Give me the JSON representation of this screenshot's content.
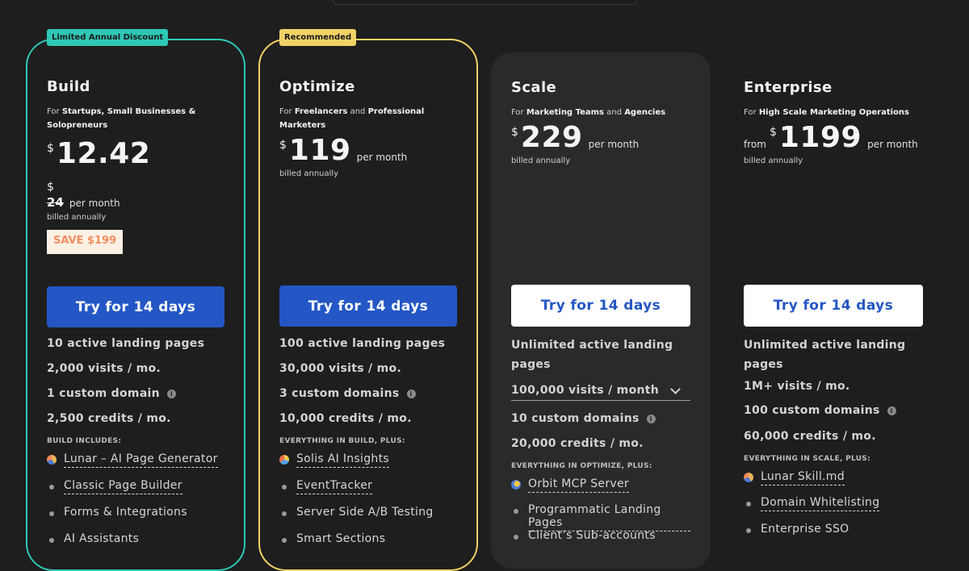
{
  "plans": [
    {
      "name": "Build",
      "badge": "Limited Annual Discount",
      "for_prefix": "For",
      "for_bold1": "Startups, Small Businesses & Solopreneurs",
      "currency": "$",
      "price": "12.42",
      "old_currency": "$",
      "old_price": "24",
      "per": "per month",
      "billed": "billed annually",
      "save": "SAVE $199",
      "cta": "Try for 14 days",
      "features": [
        "10 active landing pages",
        "2,000 visits / mo.",
        "1 custom domain",
        "2,500 credits / mo."
      ],
      "includes_head": "BUILD INCLUDES:",
      "includes": [
        "Lunar – AI Page Generator",
        "Classic Page Builder",
        "Forms & Integrations",
        "AI Assistants"
      ]
    },
    {
      "name": "Optimize",
      "badge": "Recommended",
      "for_prefix": "For",
      "for_bold1": "Freelancers",
      "for_mid": "and",
      "for_bold2": "Professional Marketers",
      "currency": "$",
      "price": "119",
      "per": "per month",
      "billed": "billed annually",
      "cta": "Try for 14 days",
      "features": [
        "100 active landing pages",
        "30,000 visits / mo.",
        "3 custom domains",
        "10,000 credits / mo."
      ],
      "includes_head": "EVERYTHING IN BUILD, PLUS:",
      "includes": [
        "Solis AI Insights",
        "EventTracker",
        "Server Side A/B Testing",
        "Smart Sections"
      ]
    },
    {
      "name": "Scale",
      "for_prefix": "For",
      "for_bold1": "Marketing Teams",
      "for_mid": "and",
      "for_bold2": "Agencies",
      "currency": "$",
      "price": "229",
      "per": "per month",
      "billed": "billed annually",
      "cta": "Try for 14 days",
      "features": [
        "Unlimited active landing pages",
        "100,000 visits / month",
        "10 custom domains",
        "20,000 credits / mo."
      ],
      "includes_head": "EVERYTHING IN OPTIMIZE, PLUS:",
      "includes": [
        "Orbit MCP Server",
        "Programmatic Landing Pages",
        "Client’s Sub-accounts"
      ]
    },
    {
      "name": "Enterprise",
      "for_prefix": "For",
      "for_bold1": "High Scale Marketing Operations",
      "from": "from",
      "currency": "$",
      "price": "1199",
      "per": "per month",
      "billed": "billed annually",
      "cta": "Try for 14 days",
      "features": [
        "Unlimited active landing pages",
        "1M+ visits / mo.",
        "100 custom domains",
        "60,000 credits / mo."
      ],
      "includes_head": "EVERYTHING IN SCALE, PLUS:",
      "includes": [
        "Lunar Skill.md",
        "Domain Whitelisting",
        "Enterprise SSO"
      ]
    }
  ],
  "icons": {
    "info": "info-icon",
    "chevron": "chevron-down-icon",
    "lunar": "lunar-icon",
    "solis": "solis-icon",
    "orbit": "orbit-icon"
  },
  "colors": {
    "build_border": "#2fc7b5",
    "optimize_border": "#f2d266",
    "cta_blue": "#2457c5",
    "save_text": "#f39060"
  }
}
